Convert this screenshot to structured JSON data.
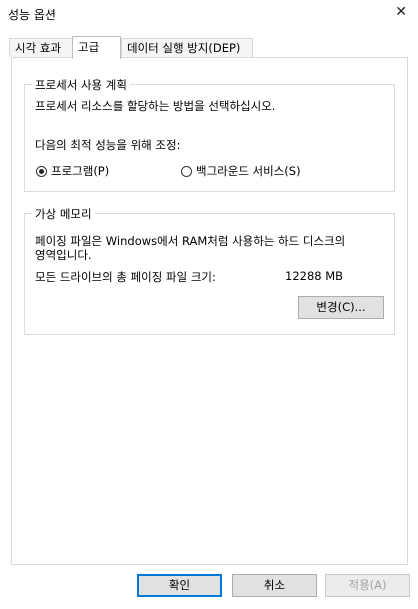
{
  "window": {
    "title": "성능 옵션",
    "close_glyph": "✕"
  },
  "tabs": [
    {
      "label": "시각 효과"
    },
    {
      "label": "고급"
    },
    {
      "label": "데이터 실행 방지(DEP)"
    }
  ],
  "processor": {
    "title": "프로세서 사용 계획",
    "description": "프로세서 리소스를 할당하는 방법을 선택하십시오.",
    "adjust_label": "다음의 최적 성능을 위해 조정:",
    "options": [
      {
        "label": "프로그램(P)",
        "selected": true
      },
      {
        "label": "백그라운드 서비스(S)",
        "selected": false
      }
    ]
  },
  "virtual_memory": {
    "title": "가상 메모리",
    "description_line1": "페이징 파일은 Windows에서 RAM처럼 사용하는 하드 디스크의",
    "description_line2": "영역입니다.",
    "total_label": "모든 드라이브의 총 페이징 파일 크기:",
    "total_value": "12288 MB",
    "change_button": "변경(C)..."
  },
  "footer": {
    "ok": "확인",
    "cancel": "취소",
    "apply": "적용(A)"
  }
}
